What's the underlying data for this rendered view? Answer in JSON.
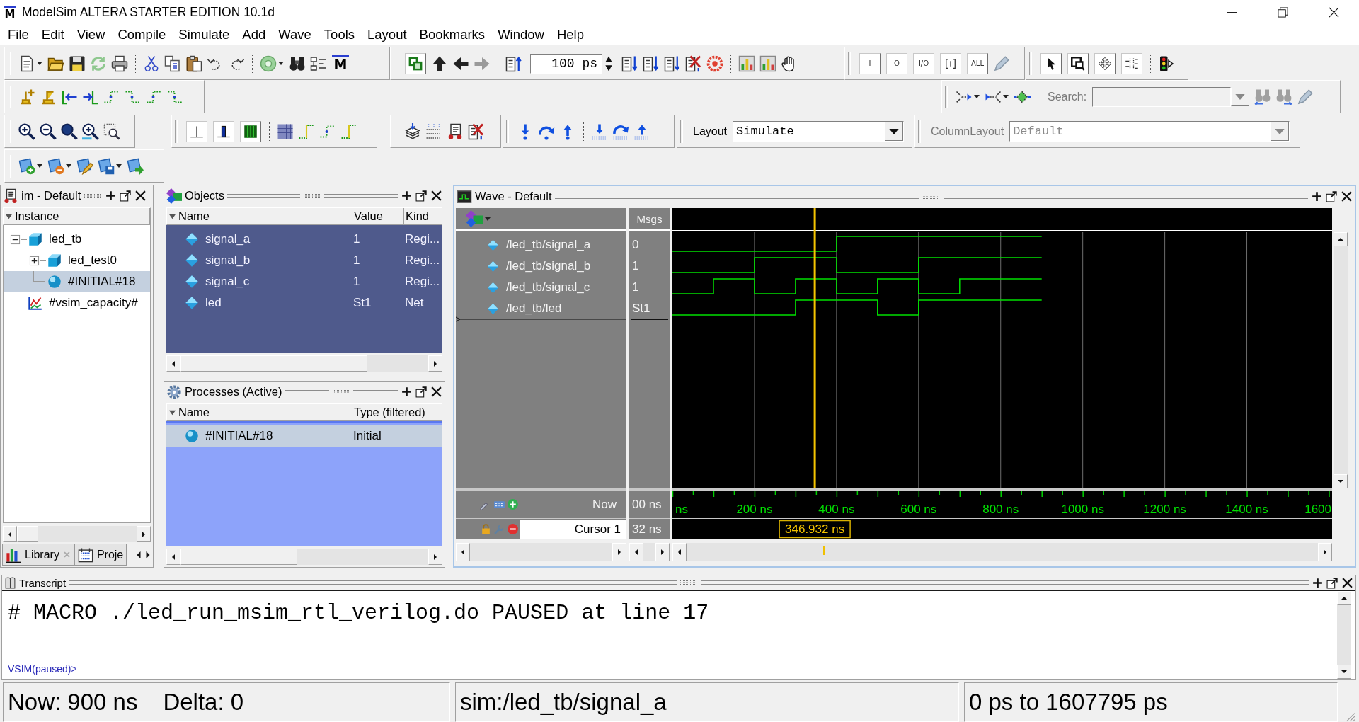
{
  "window": {
    "logo": "M",
    "title": "ModelSim ALTERA STARTER EDITION 10.1d"
  },
  "menu": [
    "File",
    "Edit",
    "View",
    "Compile",
    "Simulate",
    "Add",
    "Wave",
    "Tools",
    "Layout",
    "Bookmarks",
    "Window",
    "Help"
  ],
  "toolbar": {
    "logo_button": "M",
    "time_step": "100 ps",
    "filter_buttons": [
      {
        "kind": "text",
        "label": "I"
      },
      {
        "kind": "text",
        "label": "O"
      },
      {
        "kind": "text",
        "label": "I/O"
      },
      {
        "kind": "icon"
      },
      {
        "kind": "text",
        "label": "ALL"
      }
    ],
    "search": {
      "label": "Search:",
      "disabled": true
    },
    "layout": {
      "label": "Layout",
      "value": "Simulate",
      "disabled": false
    },
    "column_layout": {
      "label": "ColumnLayout",
      "value": "Default",
      "disabled": true
    }
  },
  "sim_panel": {
    "title": "im - Default",
    "column": "Instance",
    "tree": [
      {
        "label": "led_tb",
        "kind": "module",
        "expanded": true,
        "selected": false,
        "children": [
          {
            "label": "led_test0",
            "kind": "module",
            "expanded": false,
            "selected": false
          },
          {
            "label": "#INITIAL#18",
            "kind": "process",
            "selected": true
          }
        ]
      },
      {
        "label": "#vsim_capacity#",
        "kind": "capacity",
        "selected": false
      }
    ],
    "tabs": [
      {
        "label": "Library",
        "selected": false,
        "closable": true
      },
      {
        "label": "Proje",
        "selected": false,
        "closable": false
      }
    ]
  },
  "objects_panel": {
    "title": "Objects",
    "columns": [
      "Name",
      "Value",
      "Kind"
    ],
    "rows": [
      [
        "signal_a",
        "1",
        "Regi..."
      ],
      [
        "signal_b",
        "1",
        "Regi..."
      ],
      [
        "signal_c",
        "1",
        "Regi..."
      ],
      [
        "led",
        "St1",
        "Net"
      ]
    ]
  },
  "processes_panel": {
    "title": "Processes (Active)",
    "columns": [
      "Name",
      "Type (filtered)"
    ],
    "rows": [
      {
        "cells": [
          "#INITIAL#18",
          "Initial"
        ],
        "selected": true
      }
    ]
  },
  "wave_panel": {
    "title": "Wave - Default",
    "msgs_header": "Msgs",
    "signals": [
      {
        "name": "/led_tb/signal_a",
        "value": "0"
      },
      {
        "name": "/led_tb/signal_b",
        "value": "1"
      },
      {
        "name": "/led_tb/signal_c",
        "value": "1"
      },
      {
        "name": "/led_tb/led",
        "value": "St1"
      }
    ],
    "now_label": "Now",
    "now_value": "00 ns",
    "cursor_label": "Cursor 1",
    "cursor_value": "32 ns",
    "time_labels": [
      "ns",
      "200 ns",
      "400 ns",
      "600 ns",
      "800 ns",
      "1000 ns",
      "1200 ns",
      "1400 ns",
      "1600"
    ],
    "cursor_time": "346.932 ns"
  },
  "transcript": {
    "title": "Transcript",
    "lines": [
      "# MACRO ./led_run_msim_rtl_verilog.do PAUSED at line 17"
    ],
    "prompt": "VSIM(paused)>"
  },
  "status_bar": {
    "now": "Now: 900 ns",
    "delta": "Delta: 0",
    "path": "sim:/led_tb/signal_a",
    "range": "0 ps to 1607795 ps"
  }
}
